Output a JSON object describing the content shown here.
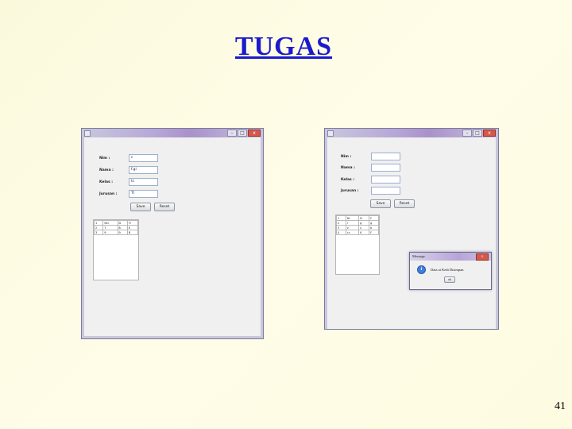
{
  "slide": {
    "title": "TUGAS",
    "page_number": "41"
  },
  "window": {
    "icon": "app-icon",
    "minimize": "–",
    "maximize": "□",
    "close": "x"
  },
  "form": {
    "labels": [
      "Nim :",
      "Nama :",
      "Kelas :",
      "Jurusan :"
    ],
    "save_label": "Save",
    "reset_label": "Reset"
  },
  "left_screenshot": {
    "values": [
      "c",
      "f.gi",
      "tc",
      "TI"
    ],
    "table": [
      [
        "1",
        "Siti",
        "D",
        "TI"
      ],
      [
        "2",
        "7",
        "8",
        "K"
      ],
      [
        "3",
        "9",
        "9",
        "B"
      ]
    ]
  },
  "right_screenshot": {
    "values": [
      "",
      "",
      "",
      ""
    ],
    "table": [
      [
        "1",
        "Ni",
        "D",
        "F"
      ],
      [
        "2",
        "i",
        "g",
        "g"
      ],
      [
        "3",
        "z",
        "z",
        "b"
      ],
      [
        "4",
        "r.c",
        "K",
        "F"
      ]
    ],
    "dialog": {
      "title": "Message",
      "close": "x",
      "icon": "info-icon",
      "message": "Data at Kedi Disimpan.",
      "ok_label": "ok"
    }
  }
}
